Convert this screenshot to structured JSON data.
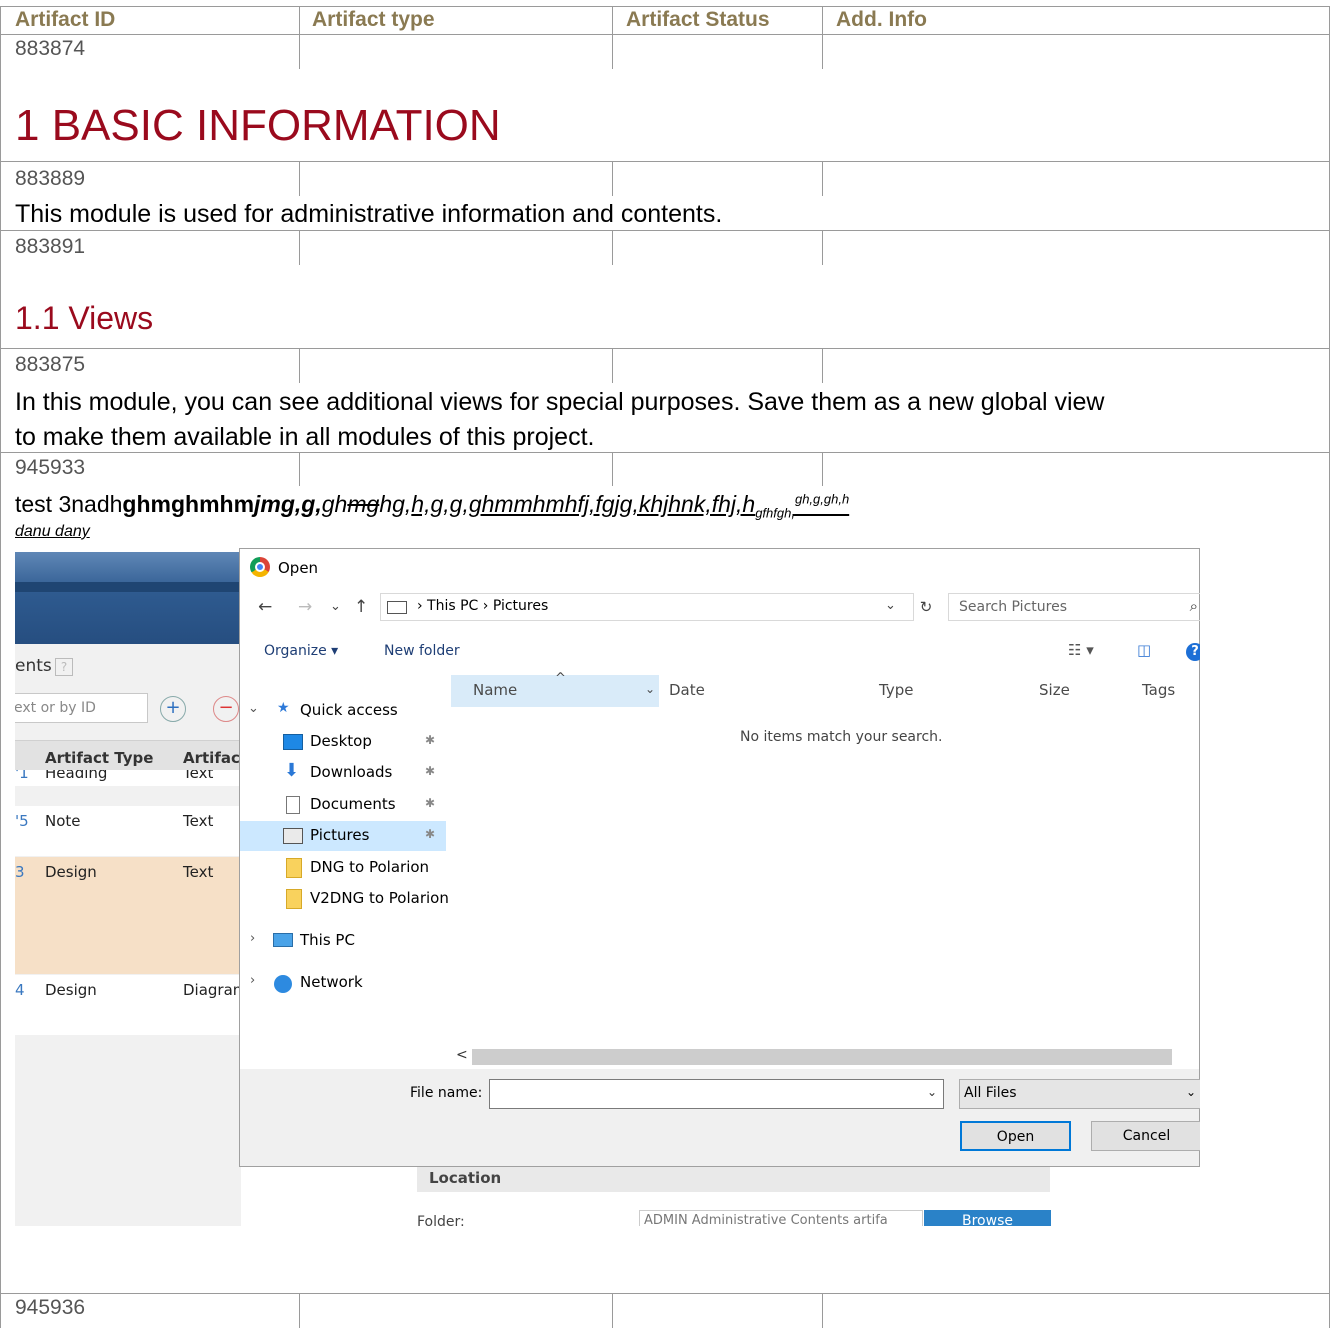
{
  "table_header": {
    "artifact_id": "Artifact ID",
    "artifact_type": "Artifact type",
    "artifact_status": "Artifact Status",
    "add_info": "Add. Info"
  },
  "rows": [
    {
      "id": "883874"
    },
    {
      "id": "883889"
    },
    {
      "id": "883891"
    },
    {
      "id": "883875"
    },
    {
      "id": "945933"
    },
    {
      "id": "945936"
    }
  ],
  "heading1": "1 BASIC INFORMATION",
  "heading2": "1.1 Views",
  "paragraph1": "This module is used for administrative information and contents.",
  "paragraph2_line1": "In this module, you can see additional views for special purposes. Save them as a new global view",
  "paragraph2_line2": "to make them available in all modules of this project.",
  "test_line": {
    "plain": "test 3nadh",
    "bold": "ghmghmhm",
    "bold_italic": "jmg,g,",
    "italic": "gh",
    "strike": "mg",
    "italic2": "hg,",
    "underline": "h,g,g,ghmmhmhfj,fgjg,khjhnk,fhj,h",
    "sub": "gfhfgh,",
    "sup": "gh,g,gh,h",
    "line2": "danu dany"
  },
  "screenshot": {
    "background": {
      "title": "ents",
      "help": "?",
      "search_placeholder": "ext or by ID",
      "add": "+",
      "remove": "−",
      "col_type": "Artifact Type",
      "col_format": "Artifact",
      "rows": [
        {
          "id": "'1",
          "type": "Heading",
          "format": "Text"
        },
        {
          "id": "'5",
          "type": "Note",
          "format": "Text"
        },
        {
          "id": "3",
          "type": "Design",
          "format": "Text"
        },
        {
          "id": "4",
          "type": "Design",
          "format": "Diagram"
        }
      ],
      "location": "Location",
      "folder_label": "Folder:",
      "folder_value": "ADMIN Administrative Contents artifa",
      "browse": "Browse"
    },
    "dialog": {
      "title": "Open",
      "back": "←",
      "forward": "→",
      "recent": "⌄",
      "up": "↑",
      "breadcrumb": "›  This PC  ›  Pictures",
      "addr_dropdown": "⌄",
      "refresh": "↻",
      "search_placeholder": "Search Pictures",
      "search_icon": "⌕",
      "organize": "Organize ▾",
      "new_folder": "New folder",
      "view_icon": "☷ ▾",
      "pane_icon": "◫",
      "help": "?",
      "nav": [
        {
          "label": "Quick access",
          "pin": "",
          "chevron": "⌄"
        },
        {
          "label": "Desktop",
          "pin": "✱",
          "chevron": ""
        },
        {
          "label": "Downloads",
          "pin": "✱",
          "chevron": ""
        },
        {
          "label": "Documents",
          "pin": "✱",
          "chevron": ""
        },
        {
          "label": "Pictures",
          "pin": "✱",
          "chevron": ""
        },
        {
          "label": "DNG to Polarion",
          "pin": "",
          "chevron": ""
        },
        {
          "label": "V2DNG to Polarion",
          "pin": "",
          "chevron": ""
        },
        {
          "label": "This PC",
          "pin": "",
          "chevron": "›"
        },
        {
          "label": "Network",
          "pin": "",
          "chevron": "›"
        }
      ],
      "columns": [
        "Name",
        "Date",
        "Type",
        "Size",
        "Tags"
      ],
      "sort_caret": "^",
      "date_caret": "⌄",
      "empty_message": "No items match your search.",
      "scroll_left": "<",
      "file_name_label": "File name:",
      "file_name_value": "",
      "file_type": "All Files",
      "dropdown": "⌄",
      "open": "Open",
      "cancel": "Cancel"
    }
  }
}
